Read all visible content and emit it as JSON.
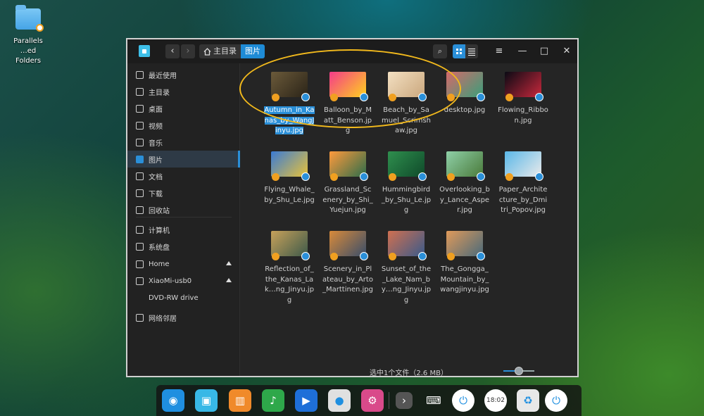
{
  "desktop": {
    "icons": [
      {
        "label_line1": "Parallels",
        "label_line2": "…ed Folders",
        "icon": "shared-folder-icon"
      }
    ]
  },
  "window": {
    "breadcrumb": {
      "home": "主目录",
      "current": "图片"
    },
    "controls": {
      "menu": "≡",
      "minimize": "—",
      "maximize": "□",
      "close": "✕"
    },
    "nav": {
      "back": "‹",
      "forward": "›"
    },
    "search_glyph": "⌕",
    "sidebar": {
      "items": [
        {
          "label": "最近使用",
          "icon": "clock-icon"
        },
        {
          "label": "主目录",
          "icon": "home-icon"
        },
        {
          "label": "桌面",
          "icon": "desktop-icon"
        },
        {
          "label": "视频",
          "icon": "video-icon"
        },
        {
          "label": "音乐",
          "icon": "music-icon"
        },
        {
          "label": "图片",
          "icon": "picture-icon",
          "active": true
        },
        {
          "label": "文档",
          "icon": "document-icon"
        },
        {
          "label": "下载",
          "icon": "download-icon"
        },
        {
          "label": "回收站",
          "icon": "trash-icon"
        },
        {
          "label": "计算机",
          "icon": "computer-icon"
        },
        {
          "label": "系统盘",
          "icon": "disk-icon"
        },
        {
          "label": "Home",
          "icon": "disk-icon"
        },
        {
          "label": "XiaoMi-usb0",
          "icon": "usb-icon"
        },
        {
          "label": "DVD-RW drive",
          "icon": ""
        },
        {
          "label": "网络邻居",
          "icon": "network-icon"
        }
      ]
    },
    "files": [
      {
        "name": "Autumn_in_Kanas_by_WangJinyu.jpg",
        "colors": [
          "#6b5a3a",
          "#2b2418"
        ],
        "selected": true
      },
      {
        "name": "Balloon_by_Matt_Benson.jpg",
        "colors": [
          "#f43b8a",
          "#ffd21e"
        ]
      },
      {
        "name": "Beach_by_Samuel_Scrimshaw.jpg",
        "colors": [
          "#f3e0c2",
          "#caa77d"
        ]
      },
      {
        "name": "desktop.jpg",
        "colors": [
          "#d46a6a",
          "#3a9e7a"
        ]
      },
      {
        "name": "Flowing_Ribbon.jpg",
        "colors": [
          "#0a0a14",
          "#c8283c"
        ]
      },
      {
        "name": "Flying_Whale_by_Shu_Le.jpg",
        "colors": [
          "#3a7bd5",
          "#e8c23a"
        ]
      },
      {
        "name": "Grassland_Scenery_by_Shi_Yuejun.jpg",
        "colors": [
          "#ff9a3c",
          "#2e6d4a"
        ]
      },
      {
        "name": "Hummingbird_by_Shu_Le.jpg",
        "colors": [
          "#2f8f4e",
          "#0f4a2a"
        ]
      },
      {
        "name": "Overlooking_by_Lance_Asper.jpg",
        "colors": [
          "#8fd0a8",
          "#4a7a3a"
        ]
      },
      {
        "name": "Paper_Architecture_by_Dmitri_Popov.jpg",
        "colors": [
          "#5ab7e8",
          "#eaeaea"
        ]
      },
      {
        "name": "Reflection_of_the_Kanas_Lake_by_Wang_Jinyu.jpg",
        "display": "Reflection_of_the_Kanas_Lak…ng_Jinyu.jpg",
        "colors": [
          "#c7a15a",
          "#3e5a4a"
        ]
      },
      {
        "name": "Scenery_in_Plateau_by_Arto_Marttinen.jpg",
        "colors": [
          "#d88a3a",
          "#3a4e6a"
        ]
      },
      {
        "name": "Sunset_of_the_Lake_Nam_by_Wang_Jinyu.jpg",
        "display": "Sunset_of_the_Lake_Nam_by…ng_Jinyu.jpg",
        "colors": [
          "#d07050",
          "#3a5a8a"
        ]
      },
      {
        "name": "The_Gongga_Mountain_by_wangjinyu.jpg",
        "colors": [
          "#e09a5a",
          "#4a6a7a"
        ]
      }
    ],
    "status": {
      "text": "选中1个文件（2.6 MB）",
      "zoom_level": 0.5
    }
  },
  "dock": {
    "items": [
      {
        "name": "launcher-icon",
        "bg": "#1f8fe0",
        "glyph": "◉"
      },
      {
        "name": "file-manager-icon",
        "bg": "#38b8e6",
        "glyph": "▣"
      },
      {
        "name": "app-store-icon",
        "bg": "#f08a2a",
        "glyph": "▥"
      },
      {
        "name": "music-icon",
        "bg": "#2ea84a",
        "glyph": "♪"
      },
      {
        "name": "video-icon",
        "bg": "#1e6fd8",
        "glyph": "▶"
      },
      {
        "name": "chrome-icon",
        "bg": "#e0e0e0",
        "glyph": "●"
      },
      {
        "name": "settings-icon",
        "bg": "#d94a8a",
        "glyph": "⚙"
      },
      {
        "name": "expand-icon",
        "bg": "#555555",
        "glyph": "›"
      },
      {
        "name": "keyboard-icon",
        "bg": "transparent",
        "glyph": "⌨"
      },
      {
        "name": "power-icon",
        "bg": "#ffffff",
        "glyph": "⏻"
      },
      {
        "name": "clock-icon",
        "bg": "#ffffff",
        "glyph": "18:02"
      },
      {
        "name": "trash-icon",
        "bg": "#e8e8e8",
        "glyph": "♻"
      },
      {
        "name": "shutdown-icon",
        "bg": "#ffffff",
        "glyph": "⏻"
      }
    ]
  }
}
